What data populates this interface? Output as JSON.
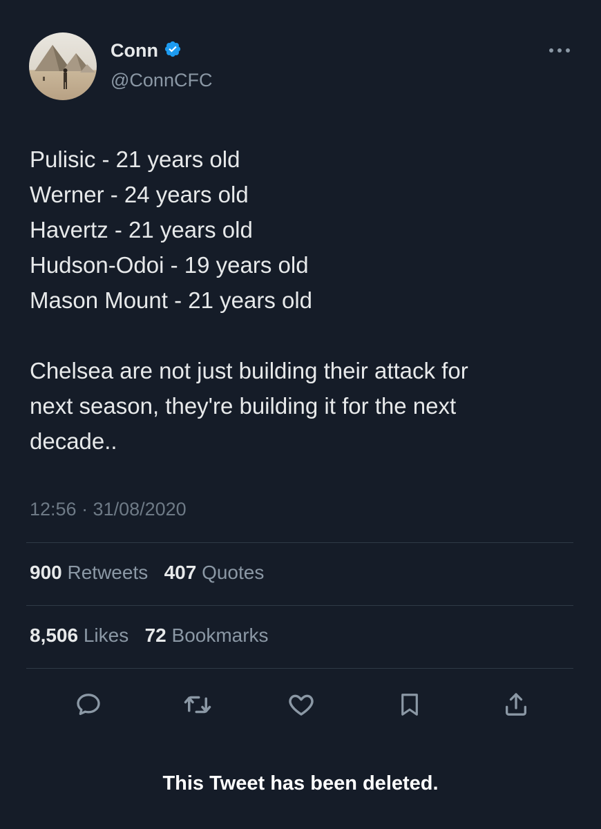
{
  "author": {
    "display_name": "Conn",
    "handle": "@ConnCFC",
    "verified": true
  },
  "tweet": {
    "lines": [
      "Pulisic - 21 years old",
      "Werner - 24 years old",
      "Havertz - 21 years old",
      "Hudson-Odoi - 19 years old",
      "Mason Mount - 21 years old"
    ],
    "paragraph_lines": [
      "Chelsea are not just building their attack for",
      "next season, they're building it for the next",
      "decade.."
    ],
    "timestamp": "12:56 · 31/08/2020"
  },
  "stats": {
    "retweets_count": "900",
    "retweets_label": "Retweets",
    "quotes_count": "407",
    "quotes_label": "Quotes",
    "likes_count": "8,506",
    "likes_label": "Likes",
    "bookmarks_count": "72",
    "bookmarks_label": "Bookmarks"
  },
  "actions": {
    "icons": [
      "reply-icon",
      "retweet-icon",
      "like-icon",
      "bookmark-icon",
      "share-icon"
    ]
  },
  "status_message": "This Tweet has been deleted.",
  "colors": {
    "background": "#151c28",
    "text": "#e7e9ea",
    "secondary": "#8b98a5",
    "verified": "#1d9bf0",
    "divider": "#2f3a46"
  }
}
